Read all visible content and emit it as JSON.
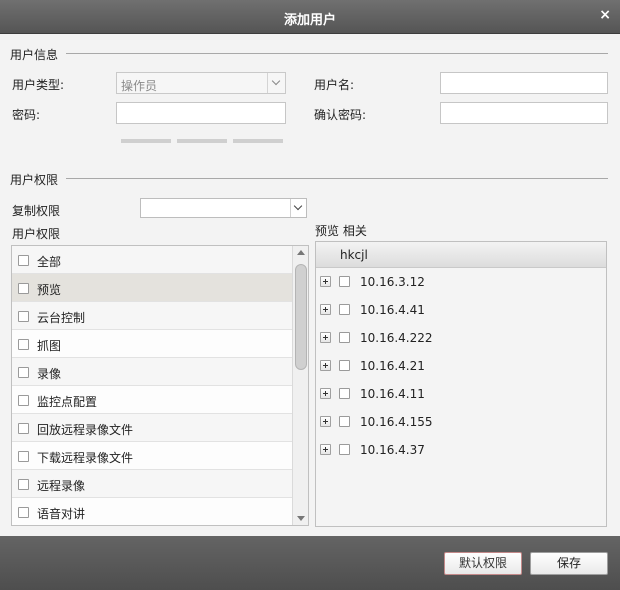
{
  "dialog": {
    "title": "添加用户",
    "close_symbol": "×"
  },
  "user_info": {
    "section_title": "用户信息",
    "user_type_label": "用户类型:",
    "user_type_value": "操作员",
    "username_label": "用户名:",
    "username_value": "",
    "password_label": "密码:",
    "password_value": "",
    "confirm_password_label": "确认密码:",
    "confirm_password_value": ""
  },
  "permissions": {
    "section_title": "用户权限",
    "copy_label": "复制权限",
    "copy_value": "",
    "list_label": "用户权限",
    "items": [
      "全部",
      "预览",
      "云台控制",
      "抓图",
      "录像",
      "监控点配置",
      "回放远程录像文件",
      "下载远程录像文件",
      "远程录像",
      "语音对讲"
    ],
    "selected_index": 1
  },
  "preview": {
    "label": "预览 相关",
    "root": "hkcjl",
    "nodes": [
      "10.16.3.12",
      "10.16.4.41",
      "10.16.4.222",
      "10.16.4.21",
      "10.16.4.11",
      "10.16.4.155",
      "10.16.4.37"
    ]
  },
  "buttons": {
    "default_perm": "默认权限",
    "save": "保存"
  }
}
